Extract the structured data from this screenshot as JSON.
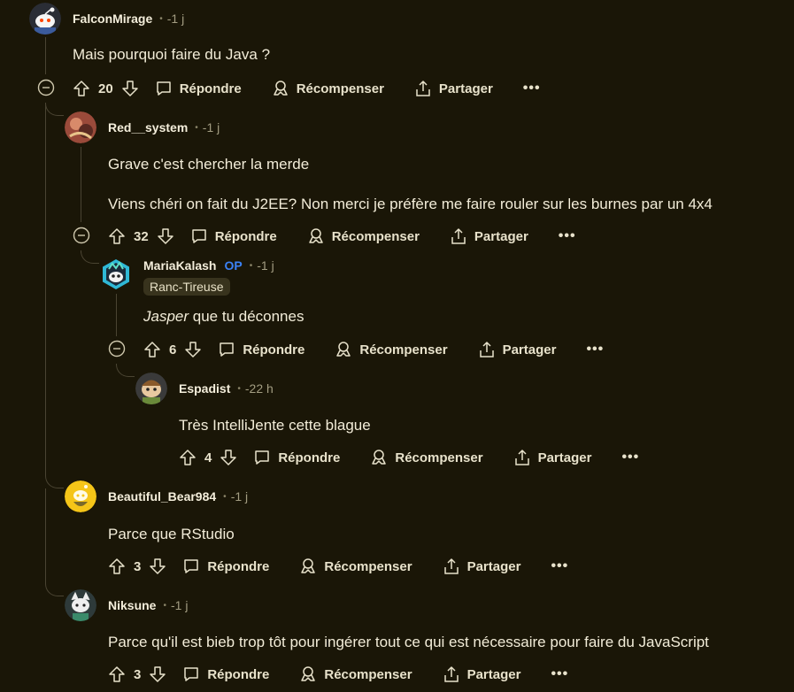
{
  "actions": {
    "reply": "Répondre",
    "award": "Récompenser",
    "share": "Partager",
    "more": "•••"
  },
  "comments": [
    {
      "author": "FalconMirage",
      "time": "-1 j",
      "avatar_icon": "reddit-snoo-avatar",
      "lines": [
        "Mais pourquoi faire du Java ?"
      ],
      "votes": "20"
    },
    {
      "author": "Red__system",
      "time": "-1 j",
      "avatar_icon": "red-avatar",
      "lines": [
        "Grave c'est chercher la merde",
        "Viens chéri on fait du J2EE? Non merci je préfère me faire rouler sur les burnes par un 4x4"
      ],
      "votes": "32"
    },
    {
      "author": "MariaKalash",
      "op": "OP",
      "time": "-1 j",
      "flair": "Ranc-Tireuse",
      "avatar_icon": "hexagon-snoo-avatar",
      "body_em": "Jasper",
      "body_rest": " que tu déconnes",
      "votes": "6"
    },
    {
      "author": "Espadist",
      "time": "-22 h",
      "avatar_icon": "snoo-avatar",
      "lines": [
        "Très IntelliJente cette blague"
      ],
      "votes": "4"
    },
    {
      "author": "Beautiful_Bear984",
      "time": "-1 j",
      "avatar_icon": "yellow-snoo-avatar",
      "lines": [
        "Parce que RStudio"
      ],
      "votes": "3"
    },
    {
      "author": "Niksune",
      "time": "-1 j",
      "avatar_icon": "white-snoo-avatar",
      "lines": [
        "Parce qu'il est bieb trop tôt pour ingérer tout ce qui est nécessaire pour faire du JavaScript"
      ],
      "votes": "3"
    }
  ]
}
